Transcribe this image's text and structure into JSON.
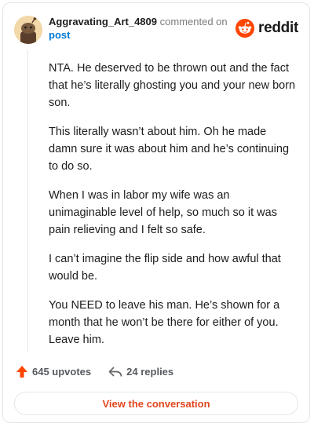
{
  "header": {
    "username": "Aggravating_Art_4809",
    "action_text": "commented on",
    "post_label": "post",
    "logo_text": "reddit",
    "avatar_icon": "snoo-avatar-icon"
  },
  "comment": {
    "paragraphs": [
      "NTA. He deserved to be thrown out and the fact that he’s literally ghosting you and your new born son.",
      "This literally wasn’t about him. Oh he made damn sure it was about him and he’s continuing to do so.",
      "When I was in labor my wife was an unimaginable level of help, so much so it was pain relieving and I felt so safe.",
      "I can’t imagine the flip side and how awful that would be.",
      "You NEED to leave his man. He’s shown for a month that he won’t be there for either of you. Leave him."
    ]
  },
  "actions": {
    "upvotes": "645 upvotes",
    "replies": "24 replies",
    "upvote_icon": "upvote-arrow-icon",
    "reply_icon": "reply-arrow-icon"
  },
  "cta": {
    "label": "View the conversation"
  },
  "colors": {
    "reddit_orange": "#ff4500",
    "link_blue": "#0079d3",
    "cta_text": "#e2461e"
  }
}
